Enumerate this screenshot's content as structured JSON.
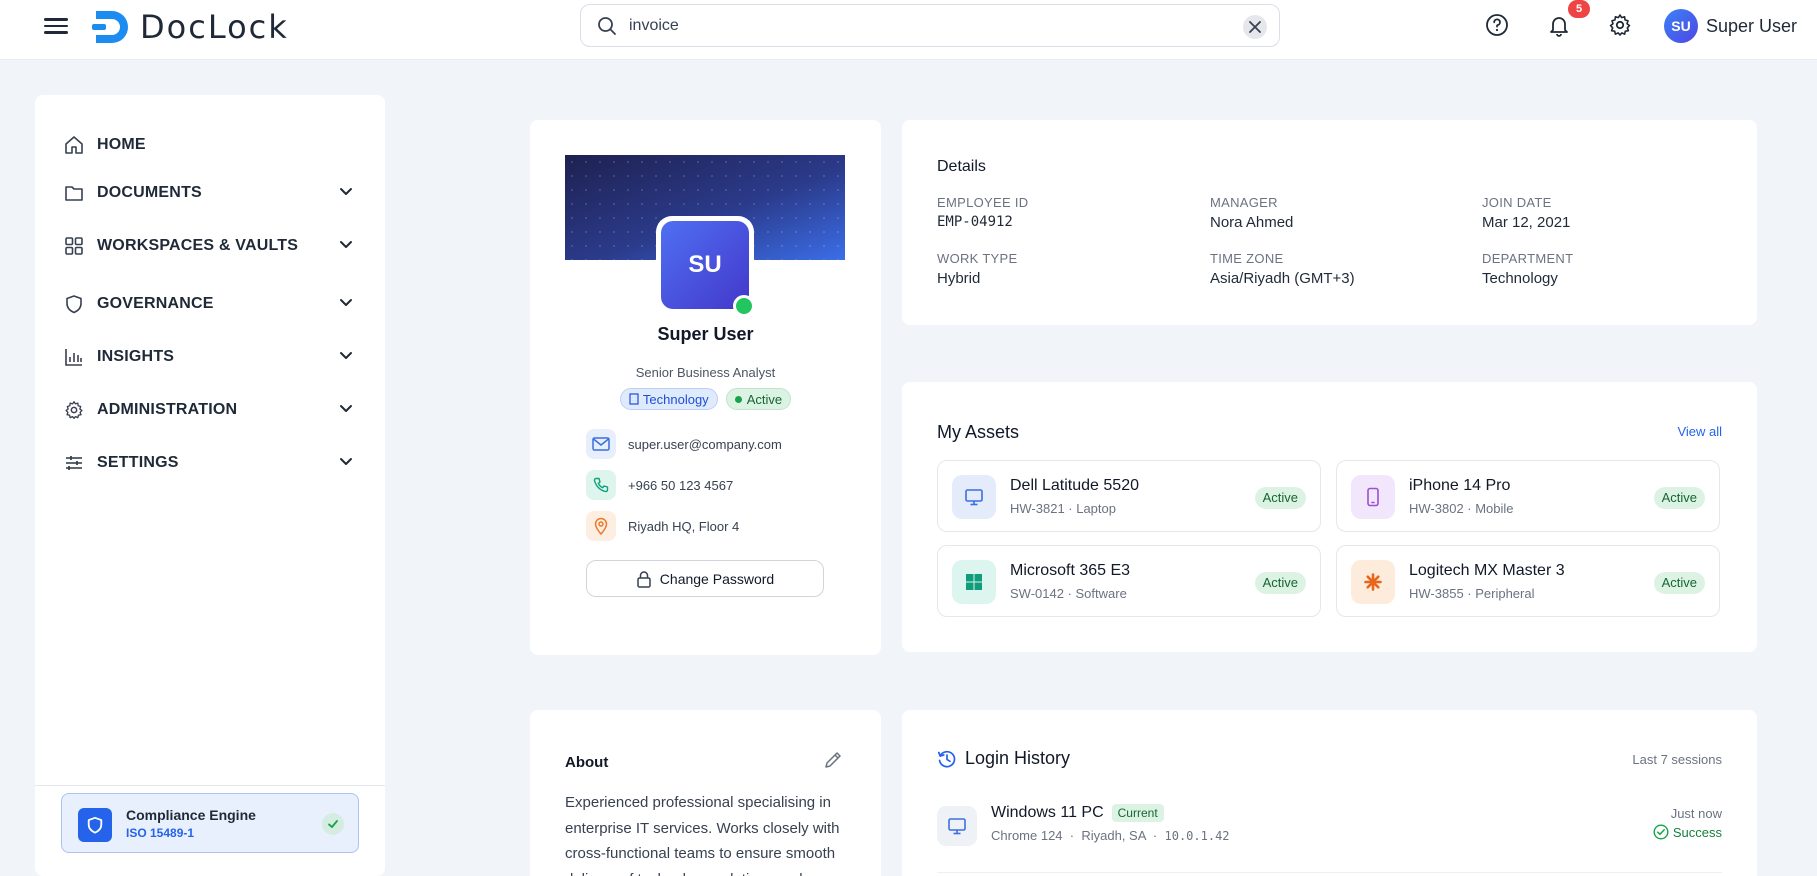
{
  "app": {
    "name": "DocLock"
  },
  "search": {
    "value": "invoice"
  },
  "header": {
    "notification_count": "5",
    "user_initials": "SU",
    "user_name": "Super User"
  },
  "sidebar": {
    "items": [
      {
        "label": "HOME",
        "icon": "home-icon"
      },
      {
        "label": "DOCUMENTS",
        "icon": "folder-icon"
      },
      {
        "label": "WORKSPACES & VAULTS",
        "icon": "grid-icon"
      },
      {
        "label": "GOVERNANCE",
        "icon": "shield-icon"
      },
      {
        "label": "INSIGHTS",
        "icon": "bar-chart-icon"
      },
      {
        "label": "ADMINISTRATION",
        "icon": "gear-icon"
      },
      {
        "label": "SETTINGS",
        "icon": "sliders-icon"
      }
    ],
    "compliance": {
      "title": "Compliance Engine",
      "standard": "ISO 15489-1"
    }
  },
  "profile": {
    "initials": "SU",
    "name": "Super User",
    "role": "Senior Business Analyst",
    "department_badge": "Technology",
    "status_badge": "Active",
    "email": "super.user@company.com",
    "phone": "+966 50 123 4567",
    "location": "Riyadh HQ, Floor 4",
    "change_password_label": "Change Password"
  },
  "details": {
    "title": "Details",
    "fields": [
      {
        "label": "EMPLOYEE ID",
        "value": "EMP-04912"
      },
      {
        "label": "MANAGER",
        "value": "Nora Ahmed"
      },
      {
        "label": "JOIN DATE",
        "value": "Mar 12, 2021"
      },
      {
        "label": "WORK TYPE",
        "value": "Hybrid"
      },
      {
        "label": "TIME ZONE",
        "value": "Asia/Riyadh (GMT+3)"
      },
      {
        "label": "DEPARTMENT",
        "value": "Technology"
      }
    ]
  },
  "assets": {
    "title": "My Assets",
    "view_all": "View all",
    "items": [
      {
        "name": "Dell Latitude 5520",
        "sub": "HW-3821 · Laptop",
        "status": "Active",
        "icon": "monitor-icon"
      },
      {
        "name": "iPhone 14 Pro",
        "sub": "HW-3802 · Mobile",
        "status": "Active",
        "icon": "phone-device-icon"
      },
      {
        "name": "Microsoft 365 E3",
        "sub": "SW-0142 · Software",
        "status": "Active",
        "icon": "windows-grid-icon"
      },
      {
        "name": "Logitech MX Master 3",
        "sub": "HW-3855 · Peripheral",
        "status": "Active",
        "icon": "asterisk-icon"
      }
    ]
  },
  "about": {
    "title": "About",
    "text": "Experienced professional specialising in enterprise IT services. Works closely with cross-functional teams to ensure smooth delivery of technology solutions and"
  },
  "login_history": {
    "title": "Login History",
    "subtitle": "Last 7 sessions",
    "sessions": [
      {
        "device": "Windows 11 PC",
        "tag": "Current",
        "browser": "Chrome 124",
        "location": "Riyadh, SA",
        "ip": "10.0.1.42",
        "time": "Just now",
        "status": "Success"
      }
    ]
  },
  "colors": {
    "accent": "#2563eb",
    "success": "#16a34a",
    "badge": "#ef4444",
    "background": "#f1f4f9"
  }
}
